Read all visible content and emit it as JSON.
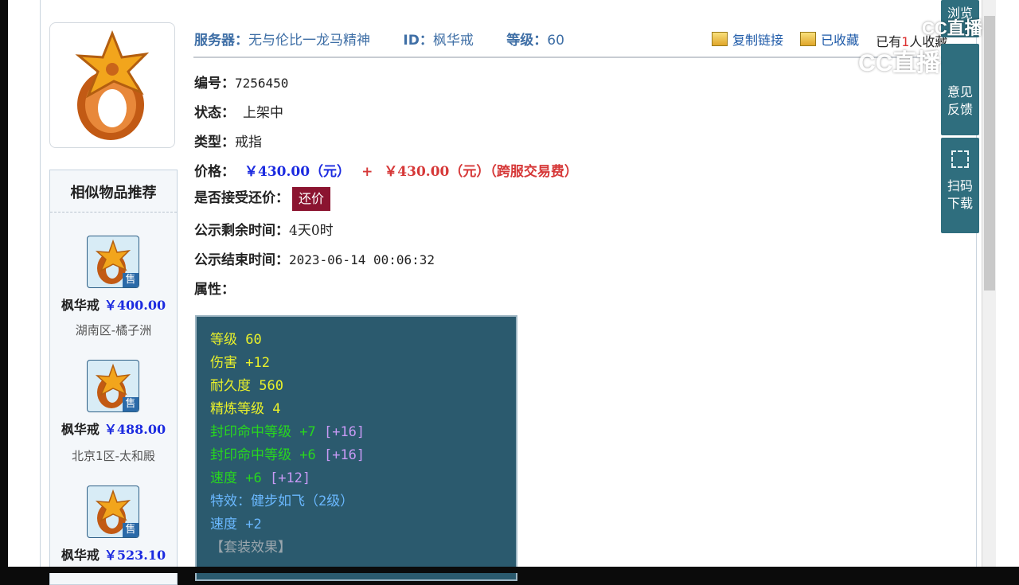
{
  "header": {
    "server_label": "服务器：",
    "server_value": "无与伦比一龙马精神",
    "id_label": "ID：",
    "id_value": "枫华戒",
    "level_label": "等级：",
    "level_value": "60"
  },
  "actions": {
    "copy_link": "复制链接",
    "favorited": "已收藏",
    "fav_prefix": "已有",
    "fav_count": "1",
    "fav_suffix": "人收藏"
  },
  "details": {
    "serial_label": "编号：",
    "serial_value": "7256450",
    "status_label": "状态：",
    "status_value": "上架中",
    "type_label": "类型：",
    "type_value": "戒指",
    "price_label": "价格：",
    "price_value": "￥430.00（元）",
    "price_plus": "+",
    "price_fee": "￥430.00（元）（跨服交易费）",
    "counter_label": "是否接受还价：",
    "counter_button": "还价",
    "remain_label": "公示剩余时间：",
    "remain_value": "4天0时",
    "end_label": "公示结束时间：",
    "end_value": "2023-06-14 00:06:32",
    "attr_label": "属性："
  },
  "attributes": [
    {
      "text": "等级 60",
      "extra": "",
      "color": "#e9f02a"
    },
    {
      "text": "伤害 +12",
      "extra": "",
      "color": "#e9f02a"
    },
    {
      "text": "耐久度 560",
      "extra": "",
      "color": "#e9f02a"
    },
    {
      "text": "精炼等级 4",
      "extra": "",
      "color": "#e9f02a"
    },
    {
      "text": "封印命中等级 +7",
      "extra": "[+16]",
      "color": "#28d61f"
    },
    {
      "text": "封印命中等级 +6",
      "extra": "[+16]",
      "color": "#28d61f"
    },
    {
      "text": "速度 +6",
      "extra": "[+12]",
      "color": "#28d61f"
    },
    {
      "text": "特效：健步如飞（2级）",
      "extra": "",
      "color": "#6ab8ff"
    },
    {
      "text": "速度 +2",
      "extra": "",
      "color": "#6ab8ff"
    },
    {
      "text": "【套装效果】",
      "extra": "",
      "color": "#9aa6ad"
    }
  ],
  "similar": {
    "title": "相似物品推荐",
    "sale_tag": "售",
    "items": [
      {
        "name": "枫华戒",
        "price": "￥400.00",
        "region": "湖南区-橘子洲"
      },
      {
        "name": "枫华戒",
        "price": "￥488.00",
        "region": "北京1区-太和殿"
      },
      {
        "name": "枫华戒",
        "price": "￥523.10",
        "region": ""
      }
    ]
  },
  "float_panel": {
    "browse": "浏览",
    "feedback_1": "意见",
    "feedback_2": "反馈",
    "scan_1": "扫码",
    "scan_2": "下载"
  },
  "watermark": {
    "text_1": "CC直播",
    "text_2": "CC直播"
  }
}
